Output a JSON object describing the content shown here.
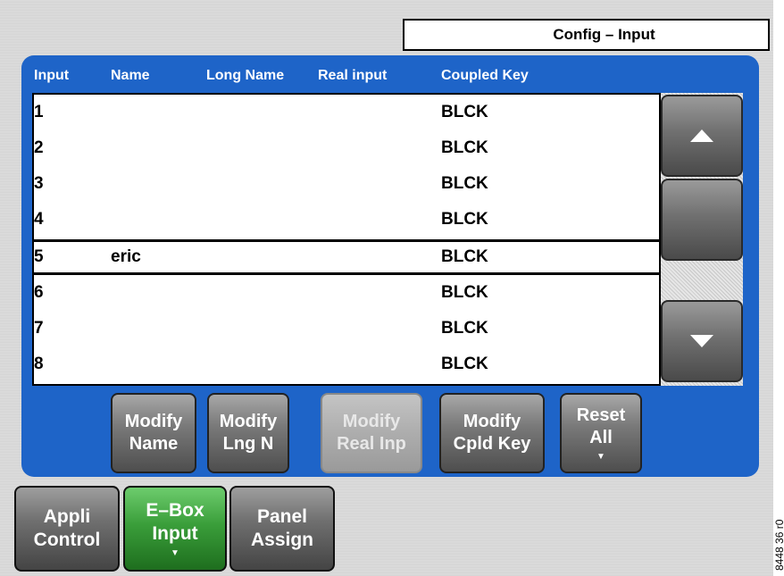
{
  "title": "Config – Input",
  "figure_id": "8448_36_r0",
  "columns": {
    "input": "Input",
    "name": "Name",
    "long_name": "Long Name",
    "real_input": "Real input",
    "coupled_key": "Coupled Key"
  },
  "rows": [
    {
      "input": "1",
      "name": "",
      "coupled_key": "BLCK"
    },
    {
      "input": "2",
      "name": "",
      "coupled_key": "BLCK"
    },
    {
      "input": "3",
      "name": "",
      "coupled_key": "BLCK"
    },
    {
      "input": "4",
      "name": "",
      "coupled_key": "BLCK"
    },
    {
      "input": "5",
      "name": "eric",
      "coupled_key": "BLCK"
    },
    {
      "input": "6",
      "name": "",
      "coupled_key": "BLCK"
    },
    {
      "input": "7",
      "name": "",
      "coupled_key": "BLCK"
    },
    {
      "input": "8",
      "name": "",
      "coupled_key": "BLCK"
    }
  ],
  "selected_row": 5,
  "scroll": {
    "up_icon": "triangle-up",
    "down_icon": "triangle-down"
  },
  "actions": {
    "modify_name": [
      "Modify",
      "Name"
    ],
    "modify_lng_n": [
      "Modify",
      "Lng N"
    ],
    "modify_real_inp": [
      "Modify",
      "Real Inp"
    ],
    "modify_cpld_key": [
      "Modify",
      "Cpld Key"
    ],
    "reset_all": [
      "Reset",
      "All"
    ]
  },
  "nav": {
    "appli_control": [
      "Appli",
      "Control"
    ],
    "ebox_input": [
      "E–Box",
      "Input"
    ],
    "panel_assign": [
      "Panel",
      "Assign"
    ]
  },
  "colors": {
    "panel": "#1e64c8",
    "active_tab": "#3a9e3a"
  }
}
